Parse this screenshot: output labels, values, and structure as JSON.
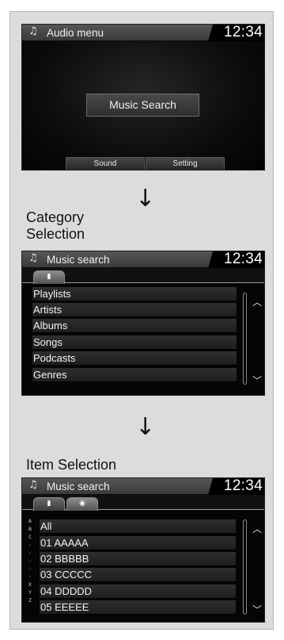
{
  "screen1": {
    "title": "Audio menu",
    "clock": "12:34",
    "center_button": "Music Search",
    "bottom_buttons": [
      "Sound",
      "Setting"
    ]
  },
  "caption1": [
    "Category",
    "Selection"
  ],
  "screen2": {
    "title": "Music search",
    "clock": "12:34",
    "items": [
      "Playlists",
      "Artists",
      "Albums",
      "Songs",
      "Podcasts",
      "Genres"
    ]
  },
  "caption2": "Item Selection",
  "screen3": {
    "title": "Music search",
    "clock": "12:34",
    "items": [
      "All",
      "01  AAAAA",
      "02  BBBBB",
      "03  CCCCC",
      "04  DDDDD",
      "05  EEEEE"
    ],
    "alpha_index": [
      "A",
      "B",
      "C",
      "·",
      "·",
      "·",
      "·",
      "·",
      "X",
      "Y",
      "Z"
    ]
  },
  "icons": {
    "music_note": "♫",
    "arrow_down": "↓",
    "scroll_up": "⌃",
    "scroll_down": "⌄",
    "category_tab": "device-icon",
    "disc_tab": "disc-icon"
  }
}
